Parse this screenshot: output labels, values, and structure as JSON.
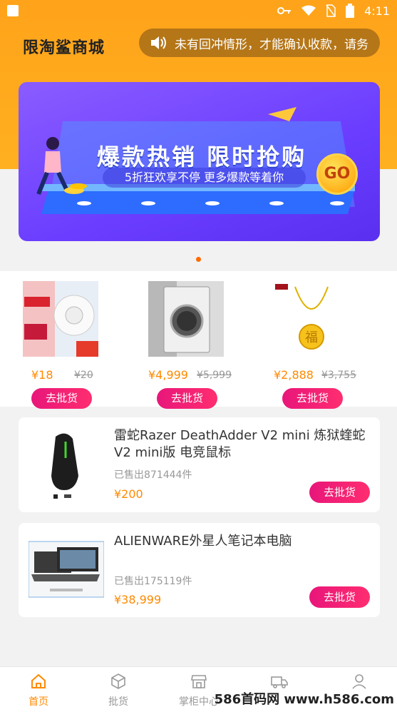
{
  "status_bar": {
    "time": "4:11"
  },
  "header": {
    "logo_text": "限淘鲨商城",
    "notice_text": "未有回冲情形，才能确认收款，请务"
  },
  "banner": {
    "title": "爆款热销 限时抢购",
    "subtitle": "5折狂欢享不停 更多爆款等着你",
    "go_label": "GO"
  },
  "products": [
    {
      "price": "¥18",
      "original_price": "¥20",
      "button": "去批货"
    },
    {
      "price": "¥4,999",
      "original_price": "¥5,999",
      "button": "去批货"
    },
    {
      "price": "¥2,888",
      "original_price": "¥3,755",
      "button": "去批货"
    }
  ],
  "list_items": [
    {
      "title": "雷蛇Razer DeathAdder V2 mini 炼狱蝰蛇V2 mini版 电竞鼠标",
      "sold": "已售出871444件",
      "price": "¥200",
      "button": "去批货"
    },
    {
      "title": "ALIENWARE外星人笔记本电脑",
      "sold": "已售出175119件",
      "price": "¥38,999",
      "button": "去批货"
    }
  ],
  "tabs": [
    {
      "label": "首页",
      "icon": "home-icon",
      "active": true
    },
    {
      "label": "批货",
      "icon": "box-icon",
      "active": false
    },
    {
      "label": "掌柜中心",
      "icon": "store-icon",
      "active": false
    },
    {
      "label": "",
      "icon": "truck-icon",
      "active": false
    },
    {
      "label": "",
      "icon": "user-icon",
      "active": false
    }
  ],
  "watermark": "586首码网 www.h586.com",
  "colors": {
    "accent": "#ff8a00",
    "button": "#e8167a",
    "header_bg": "#ffa31a"
  }
}
